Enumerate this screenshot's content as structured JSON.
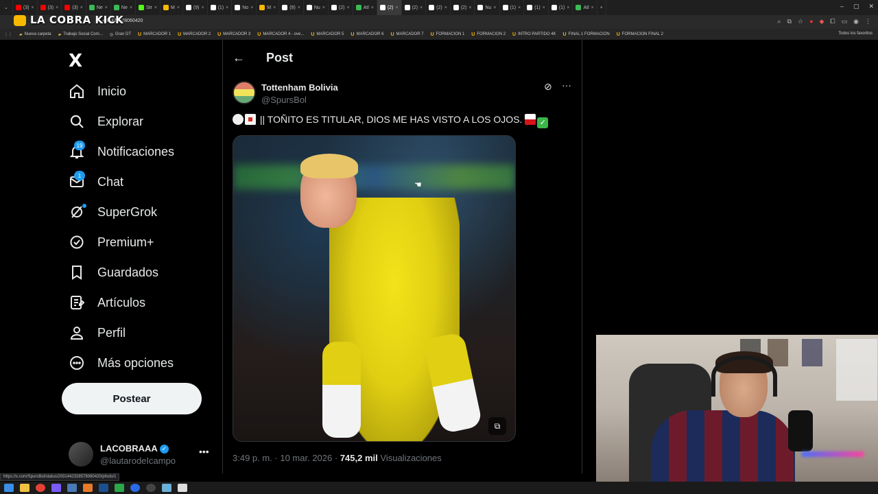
{
  "browser": {
    "tabs": [
      {
        "label": "(3)",
        "color": "#ff0000"
      },
      {
        "label": "(3)",
        "color": "#ff0000"
      },
      {
        "label": "(3)",
        "color": "#ff0000"
      },
      {
        "label": "Ne",
        "color": "#3cba54"
      },
      {
        "label": "Ne",
        "color": "#3cba54"
      },
      {
        "label": "Str",
        "color": "#53fc18"
      },
      {
        "label": "M",
        "color": "#f6b800"
      },
      {
        "label": "(9)",
        "color": "#ffffff"
      },
      {
        "label": "(1)",
        "color": "#ffffff"
      },
      {
        "label": "No",
        "color": "#ffffff"
      },
      {
        "label": "M",
        "color": "#f6b800"
      },
      {
        "label": "(9)",
        "color": "#ffffff"
      },
      {
        "label": "Nu",
        "color": "#ffffff"
      },
      {
        "label": "(2)",
        "color": "#ffffff"
      },
      {
        "label": "Atl",
        "color": "#3cba54"
      },
      {
        "label": "(2)",
        "color": "#ffffff",
        "active": true
      },
      {
        "label": "(2)",
        "color": "#ffffff"
      },
      {
        "label": "(2)",
        "color": "#ffffff"
      },
      {
        "label": "(2)",
        "color": "#ffffff"
      },
      {
        "label": "Nu",
        "color": "#ffffff"
      },
      {
        "label": "(1)",
        "color": "#ffffff"
      },
      {
        "label": "(1)",
        "color": "#ffffff"
      },
      {
        "label": "(1)",
        "color": "#ffffff"
      },
      {
        "label": "Atl",
        "color": "#3cba54"
      }
    ],
    "url": "442328578060420",
    "overlay_logo": "LA COBRA KICK",
    "bookmarks": [
      {
        "label": "Nueva carpeta",
        "icon": "folder"
      },
      {
        "label": "Trabajo Social Com...",
        "icon": "folder"
      },
      {
        "label": "Gran DT",
        "icon": "globe"
      },
      {
        "label": "MARCADOR 1",
        "icon": "u"
      },
      {
        "label": "MARCADOR 2",
        "icon": "u"
      },
      {
        "label": "MARCADOR 3",
        "icon": "u"
      },
      {
        "label": "MARCADOR 4 - ove...",
        "icon": "u"
      },
      {
        "label": "MARCADOR 5",
        "icon": "u"
      },
      {
        "label": "MARCADOR 6",
        "icon": "u"
      },
      {
        "label": "MARCADOR 7",
        "icon": "u"
      },
      {
        "label": "FORMACION 1",
        "icon": "u"
      },
      {
        "label": "FORMACION 2",
        "icon": "u"
      },
      {
        "label": "INTRO PARTIDO 4K",
        "icon": "u"
      },
      {
        "label": "FINAL 1 FORMACION",
        "icon": "u"
      },
      {
        "label": "FORMACION FINAL 2",
        "icon": "u"
      }
    ],
    "bookmarks_right": "Todos los favoritos",
    "status_url": "https://x.com/SpursBol/status/2031442328578060420/photo/1"
  },
  "sidebar": {
    "logo": "X",
    "items": [
      {
        "label": "Inicio",
        "icon": "home-icon"
      },
      {
        "label": "Explorar",
        "icon": "search-icon"
      },
      {
        "label": "Notificaciones",
        "icon": "bell-icon",
        "badge": "19"
      },
      {
        "label": "Chat",
        "icon": "mail-icon",
        "badge": "1"
      },
      {
        "label": "SuperGrok",
        "icon": "grok-icon",
        "dot": true
      },
      {
        "label": "Premium+",
        "icon": "verified-icon"
      },
      {
        "label": "Guardados",
        "icon": "bookmark-icon"
      },
      {
        "label": "Artículos",
        "icon": "article-icon"
      },
      {
        "label": "Perfil",
        "icon": "person-icon"
      },
      {
        "label": "Más opciones",
        "icon": "more-circle-icon"
      }
    ],
    "post_button": "Postear",
    "account": {
      "name": "LACOBRAAA",
      "handle": "@lautarodeIcampo"
    }
  },
  "post": {
    "header_title": "Post",
    "author_name": "Tottenham Bolivia",
    "author_handle": "@SpursBol",
    "text": "|| TOÑITO ES TITULAR, DIOS ME HAS VISTO A LOS OJOS.",
    "time": "3:49 p. m. · 10 mar. 2026 ·",
    "views_count": "745,2 mil",
    "views_label": "Visualizaciones"
  },
  "colors": {
    "accent": "#1d9bf0",
    "background": "#000000",
    "text": "#e7e9ea",
    "muted": "#71767b"
  }
}
